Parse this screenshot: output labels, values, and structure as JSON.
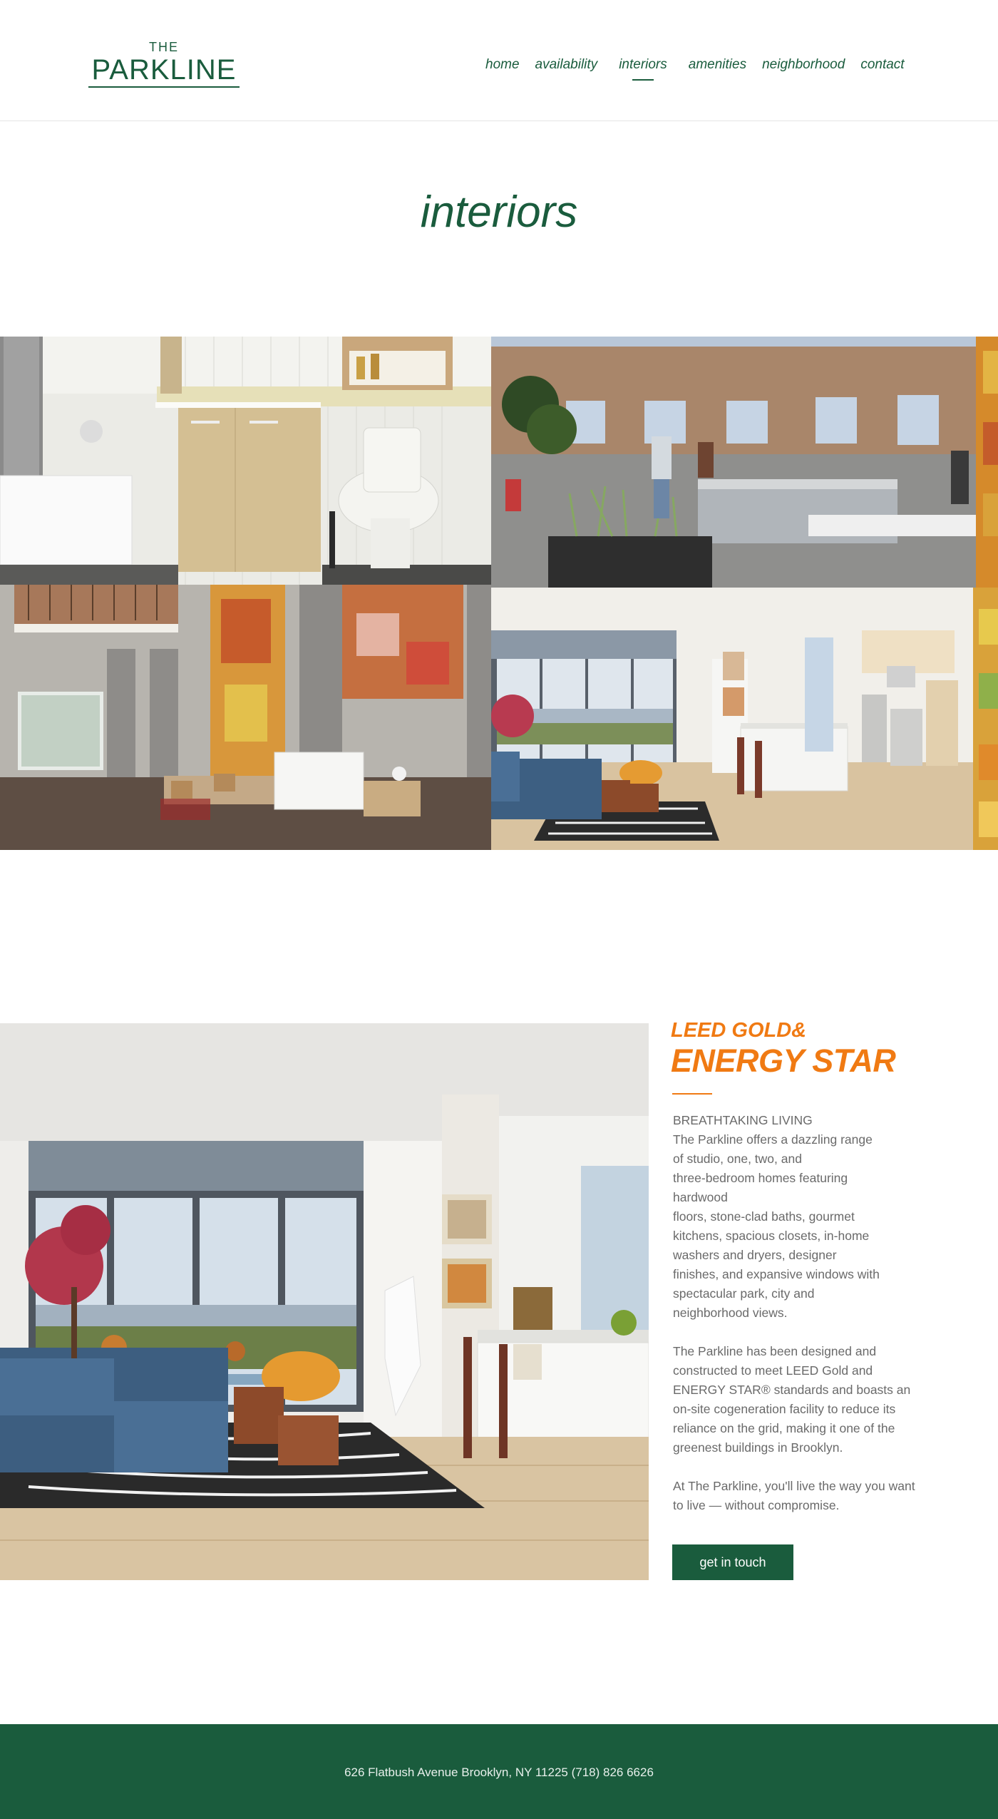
{
  "brand": {
    "line1": "THE",
    "line2": "PARKLINE"
  },
  "nav": [
    {
      "label": "home",
      "active": false
    },
    {
      "label": "availability",
      "active": false
    },
    {
      "label": "interiors",
      "active": true
    },
    {
      "label": "amenities",
      "active": false
    },
    {
      "label": "neighborhood",
      "active": false
    },
    {
      "label": "contact",
      "active": false
    }
  ],
  "page_title": "interiors",
  "feature": {
    "heading_small": "LEED GOLD&",
    "heading_big": "ENERGY STAR",
    "subhead": "BREATHTAKING LIVING",
    "para1": "The Parkline offers a dazzling range\nof studio, one, two, and\nthree-bedroom homes featuring\nhardwood\nfloors, stone-clad baths, gourmet\nkitchens, spacious closets, in-home\nwashers and dryers, designer\nfinishes, and expansive windows with\nspectacular park, city and\nneighborhood views.",
    "para2": "The Parkline has been designed and constructed to meet LEED Gold and ENERGY STAR® standards and boasts an on-site cogeneration facility to reduce its reliance on the grid, making it one of the greenest buildings in Brooklyn.",
    "para3": "At The Parkline, you'll live the way you want to live — without compromise.",
    "cta_label": "get in touch"
  },
  "footer": {
    "address": "626 Flatbush Avenue Brooklyn, NY 11225 (718) 826 6626"
  },
  "colors": {
    "brand_green": "#1a5c3d",
    "accent_orange": "#f07a13"
  }
}
